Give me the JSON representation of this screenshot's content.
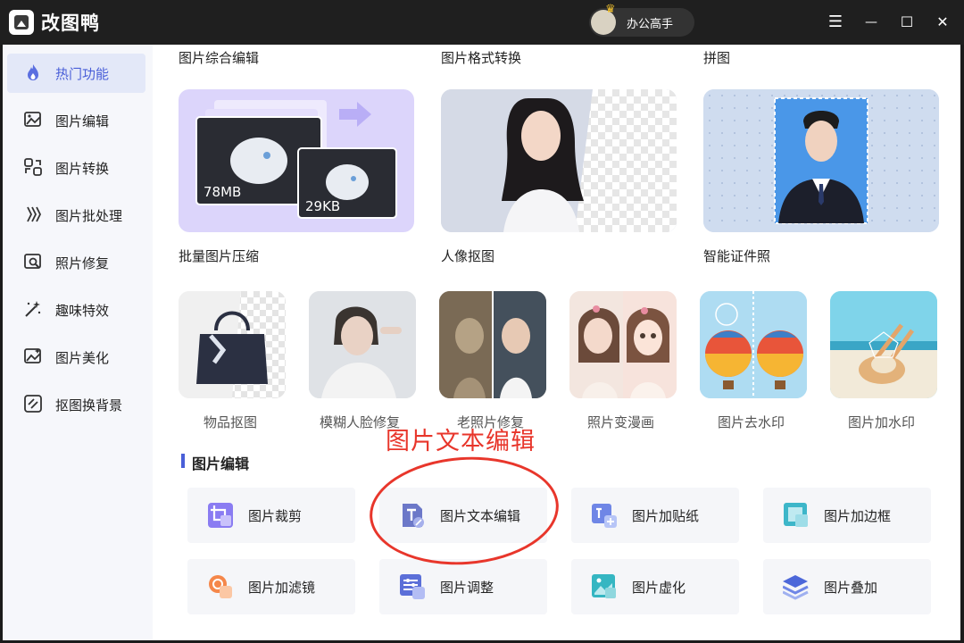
{
  "app": {
    "title": "改图鸭",
    "user_name": "办公高手"
  },
  "window_controls": {
    "menu": "☰",
    "minimize": "—",
    "maximize": "☐",
    "close": "✕"
  },
  "sidebar": {
    "items": [
      {
        "label": "热门功能",
        "icon": "flame-icon",
        "active": true
      },
      {
        "label": "图片编辑",
        "icon": "image-edit-icon"
      },
      {
        "label": "图片转换",
        "icon": "convert-icon"
      },
      {
        "label": "图片批处理",
        "icon": "batch-icon"
      },
      {
        "label": "照片修复",
        "icon": "repair-icon"
      },
      {
        "label": "趣味特效",
        "icon": "magic-wand-icon"
      },
      {
        "label": "图片美化",
        "icon": "beautify-icon"
      },
      {
        "label": "抠图换背景",
        "icon": "cutout-icon"
      }
    ]
  },
  "hot": {
    "top_labels": [
      "图片综合编辑",
      "图片格式转换",
      "拼图"
    ],
    "big_cards": [
      {
        "label": "批量图片压缩",
        "size_before": "78MB",
        "size_after": "29KB"
      },
      {
        "label": "人像抠图"
      },
      {
        "label": "智能证件照"
      }
    ],
    "small_cards": [
      {
        "label": "物品抠图"
      },
      {
        "label": "模糊人脸修复"
      },
      {
        "label": "老照片修复"
      },
      {
        "label": "照片变漫画"
      },
      {
        "label": "图片去水印"
      },
      {
        "label": "图片加水印"
      }
    ]
  },
  "section": {
    "title": "图片编辑"
  },
  "tools": [
    {
      "label": "图片裁剪",
      "icon": "crop-icon"
    },
    {
      "label": "图片文本编辑",
      "icon": "text-edit-icon"
    },
    {
      "label": "图片加贴纸",
      "icon": "sticker-icon"
    },
    {
      "label": "图片加边框",
      "icon": "border-icon"
    },
    {
      "label": "图片加滤镜",
      "icon": "filter-icon"
    },
    {
      "label": "图片调整",
      "icon": "adjust-icon"
    },
    {
      "label": "图片虚化",
      "icon": "blur-icon"
    },
    {
      "label": "图片叠加",
      "icon": "layers-icon"
    }
  ],
  "annotation": {
    "text": "图片文本编辑"
  },
  "colors": {
    "accent": "#4a5fd8",
    "annotation": "#e8362b",
    "titlebar": "#1f1f1f",
    "sidebar_bg": "#f6f7fb",
    "active_bg": "#e3e8f8"
  }
}
